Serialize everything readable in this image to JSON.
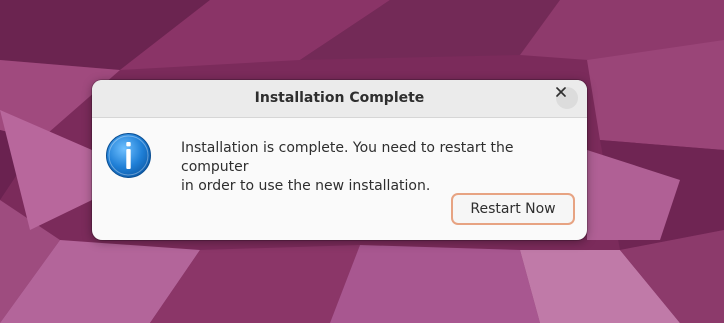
{
  "dialog": {
    "title": "Installation Complete",
    "message_line1": "Installation is complete. You need to restart the computer",
    "message_line2": "in order to use the new installation.",
    "restart_label": "Restart Now",
    "close_icon": "close-icon",
    "info_icon": "info-icon"
  },
  "colors": {
    "desktop_base": "#7a2a5a",
    "button_border_accent": "#e7a382",
    "info_blue": "#1f7fd6"
  }
}
